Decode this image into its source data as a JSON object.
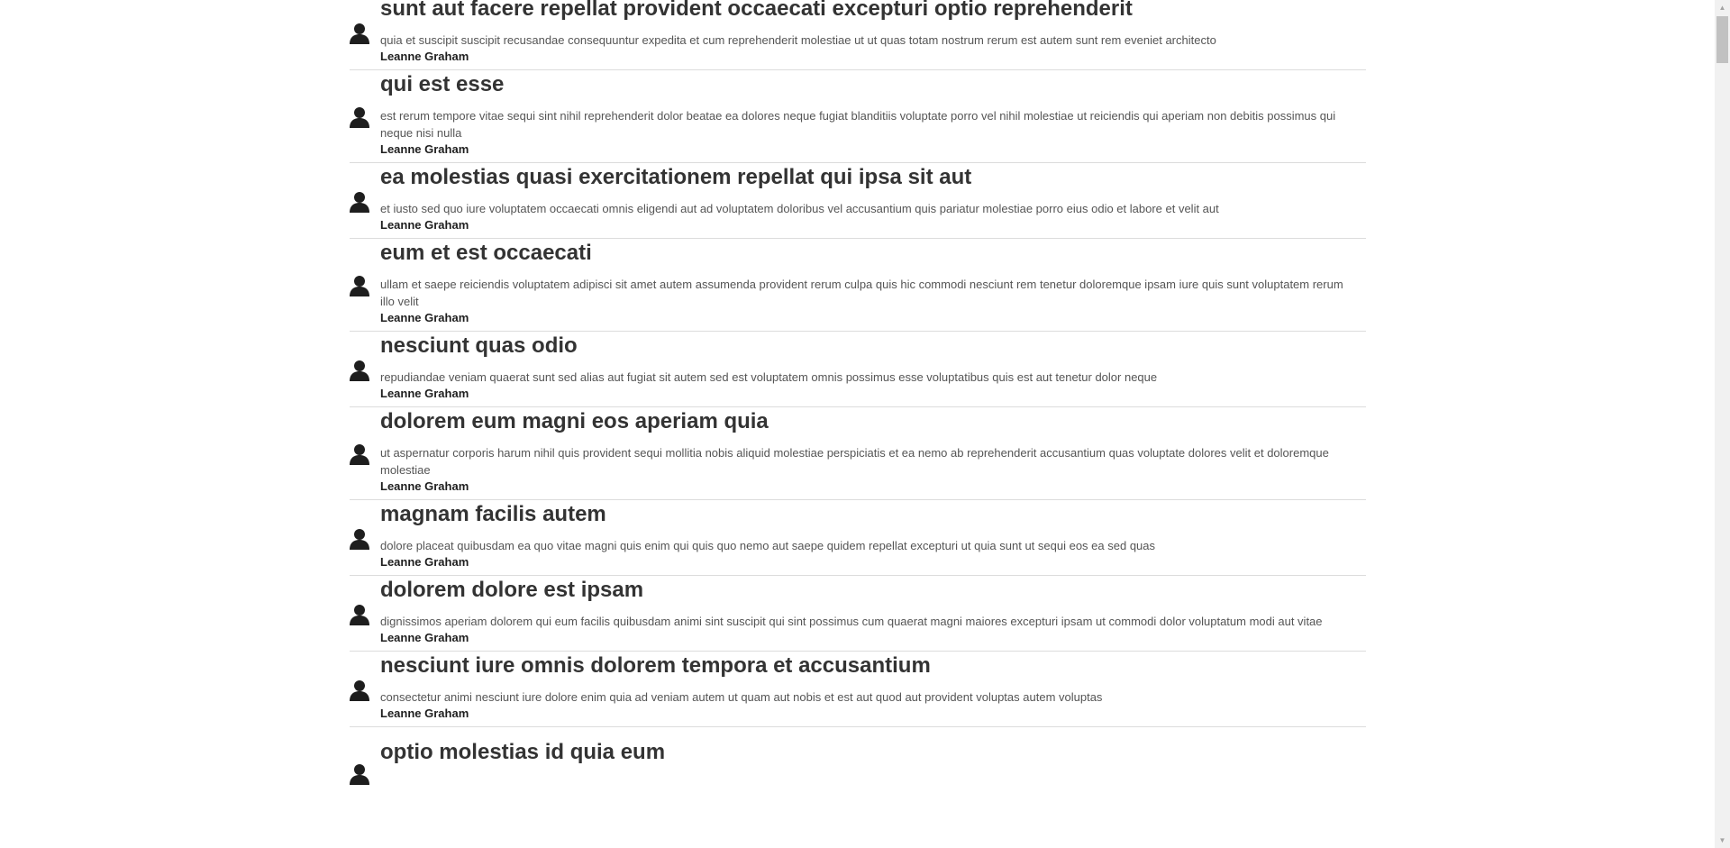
{
  "posts": [
    {
      "title": "sunt aut facere repellat provident occaecati excepturi optio reprehenderit",
      "body": "quia et suscipit suscipit recusandae consequuntur expedita et cum reprehenderit molestiae ut ut quas totam nostrum rerum est autem sunt rem eveniet architecto",
      "author": "Leanne Graham"
    },
    {
      "title": "qui est esse",
      "body": "est rerum tempore vitae sequi sint nihil reprehenderit dolor beatae ea dolores neque fugiat blanditiis voluptate porro vel nihil molestiae ut reiciendis qui aperiam non debitis possimus qui neque nisi nulla",
      "author": "Leanne Graham"
    },
    {
      "title": "ea molestias quasi exercitationem repellat qui ipsa sit aut",
      "body": "et iusto sed quo iure voluptatem occaecati omnis eligendi aut ad voluptatem doloribus vel accusantium quis pariatur molestiae porro eius odio et labore et velit aut",
      "author": "Leanne Graham"
    },
    {
      "title": "eum et est occaecati",
      "body": "ullam et saepe reiciendis voluptatem adipisci sit amet autem assumenda provident rerum culpa quis hic commodi nesciunt rem tenetur doloremque ipsam iure quis sunt voluptatem rerum illo velit",
      "author": "Leanne Graham"
    },
    {
      "title": "nesciunt quas odio",
      "body": "repudiandae veniam quaerat sunt sed alias aut fugiat sit autem sed est voluptatem omnis possimus esse voluptatibus quis est aut tenetur dolor neque",
      "author": "Leanne Graham"
    },
    {
      "title": "dolorem eum magni eos aperiam quia",
      "body": "ut aspernatur corporis harum nihil quis provident sequi mollitia nobis aliquid molestiae perspiciatis et ea nemo ab reprehenderit accusantium quas voluptate dolores velit et doloremque molestiae",
      "author": "Leanne Graham"
    },
    {
      "title": "magnam facilis autem",
      "body": "dolore placeat quibusdam ea quo vitae magni quis enim qui quis quo nemo aut saepe quidem repellat excepturi ut quia sunt ut sequi eos ea sed quas",
      "author": "Leanne Graham"
    },
    {
      "title": "dolorem dolore est ipsam",
      "body": "dignissimos aperiam dolorem qui eum facilis quibusdam animi sint suscipit qui sint possimus cum quaerat magni maiores excepturi ipsam ut commodi dolor voluptatum modi aut vitae",
      "author": "Leanne Graham"
    },
    {
      "title": "nesciunt iure omnis dolorem tempora et accusantium",
      "body": "consectetur animi nesciunt iure dolore enim quia ad veniam autem ut quam aut nobis et est aut quod aut provident voluptas autem voluptas",
      "author": "Leanne Graham"
    },
    {
      "title": "optio molestias id quia eum",
      "body": "",
      "author": ""
    }
  ],
  "icons": {
    "avatar": "user-icon",
    "scroll_up": "scroll-up-arrow-icon",
    "scroll_down": "scroll-down-arrow-icon"
  },
  "colors": {
    "title": "#333333",
    "body": "#555555",
    "author": "#1e1e1e",
    "divider": "#dcdcdc",
    "icon": "#1e1e1e"
  }
}
